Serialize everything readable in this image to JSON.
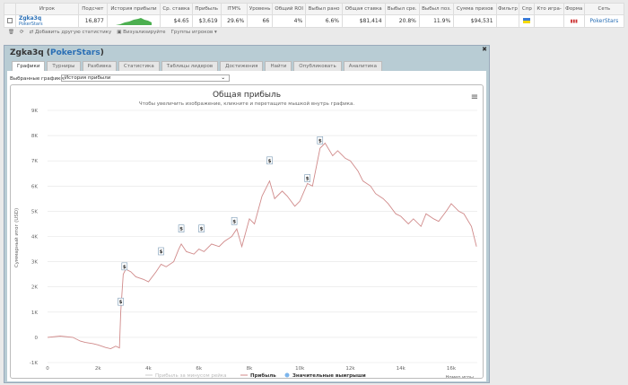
{
  "table": {
    "headers": [
      "",
      "Игрок",
      "Подсчет",
      "История прибыли",
      "Ср. ставка",
      "Прибыль",
      "ITM%",
      "Уровень",
      "Общий ROI",
      "Выбыл рано",
      "Общая ставка",
      "Выбыл сре.",
      "Выбыл поз.",
      "Сумма призов",
      "Фильтр",
      "Спр",
      "Кто игра-",
      "Форма",
      "Сеть"
    ],
    "row": {
      "player": "Zgka3q",
      "network_sub": "PokerStars",
      "count": "16,877",
      "avg_stake": "$4.65",
      "profit": "$3,619",
      "itm": "29.6%",
      "level": "66",
      "roi": "4%",
      "early": "6.6%",
      "total_stake": "$81,414",
      "mid": "20.8%",
      "late": "11.9%",
      "prizes": "$94,531",
      "network": "PokerStars"
    }
  },
  "toolbar": {
    "add_stats": "Добавить другую статистику",
    "visualize": "Визуализируйте",
    "groups": "Группы игроков"
  },
  "panel": {
    "player": "Zgka3q",
    "network": "PokerStars",
    "tabs": [
      "Графики",
      "Турниры",
      "Разбивка",
      "Статистика",
      "Таблицы лидеров",
      "Достижения",
      "Найти",
      "Опубликовать",
      "Аналитика"
    ],
    "selected_label": "Выбранные графики:",
    "selected_value": "История прибыли"
  },
  "chart_data": {
    "type": "line",
    "title": "Общая прибыль",
    "subtitle": "Чтобы увеличить изображение, кликните и перетащите мышкой внутрь графика.",
    "xlabel": "Номер игры",
    "ylabel": "Суммарный итог (USD)",
    "xlim": [
      0,
      17000
    ],
    "ylim": [
      -1000,
      9000
    ],
    "xticks": [
      "0",
      "2k",
      "4k",
      "6k",
      "8k",
      "10k",
      "12k",
      "14k",
      "16k"
    ],
    "yticks": [
      "-1K",
      "0",
      "1K",
      "2K",
      "3K",
      "4K",
      "5K",
      "6K",
      "7K",
      "8K",
      "9K"
    ],
    "legend": [
      "Прибыль за минусом рейка",
      "Прибыль",
      "Значительные выигрыши"
    ],
    "series": [
      {
        "name": "Прибыль",
        "color": "#d08a8a",
        "x": [
          0,
          500,
          1000,
          1300,
          1500,
          1800,
          2000,
          2300,
          2500,
          2700,
          2850,
          2900,
          3000,
          3100,
          3300,
          3500,
          3800,
          4000,
          4300,
          4500,
          4700,
          5000,
          5200,
          5300,
          5500,
          5800,
          6000,
          6200,
          6500,
          6800,
          7000,
          7300,
          7500,
          7700,
          8000,
          8200,
          8500,
          8800,
          9000,
          9300,
          9500,
          9800,
          10000,
          10300,
          10500,
          10800,
          11000,
          11300,
          11500,
          11800,
          12000,
          12300,
          12500,
          12800,
          13000,
          13300,
          13500,
          13800,
          14000,
          14300,
          14500,
          14800,
          15000,
          15300,
          15500,
          15800,
          16000,
          16300,
          16500,
          16800,
          17000
        ],
        "y": [
          0,
          50,
          0,
          -150,
          -200,
          -250,
          -300,
          -400,
          -450,
          -350,
          -420,
          1000,
          2500,
          2700,
          2600,
          2400,
          2300,
          2200,
          2600,
          2900,
          2800,
          3000,
          3500,
          3700,
          3400,
          3300,
          3500,
          3400,
          3700,
          3600,
          3800,
          4000,
          4300,
          3600,
          4700,
          4500,
          5600,
          6200,
          5500,
          5800,
          5600,
          5200,
          5400,
          6100,
          6000,
          7500,
          7700,
          7200,
          7400,
          7100,
          7000,
          6600,
          6200,
          6000,
          5700,
          5500,
          5300,
          4900,
          4800,
          4500,
          4700,
          4400,
          4900,
          4700,
          4600,
          5000,
          5300,
          5000,
          4900,
          4400,
          3600
        ]
      },
      {
        "name": "Значительные выигрыши",
        "color": "#7cb5ec",
        "x": [
          2900,
          3050,
          4500,
          5300,
          6100,
          7400,
          8800,
          10300,
          10800
        ],
        "y": [
          1200,
          2600,
          3200,
          4100,
          4100,
          4400,
          6800,
          6100,
          7600
        ]
      }
    ]
  }
}
